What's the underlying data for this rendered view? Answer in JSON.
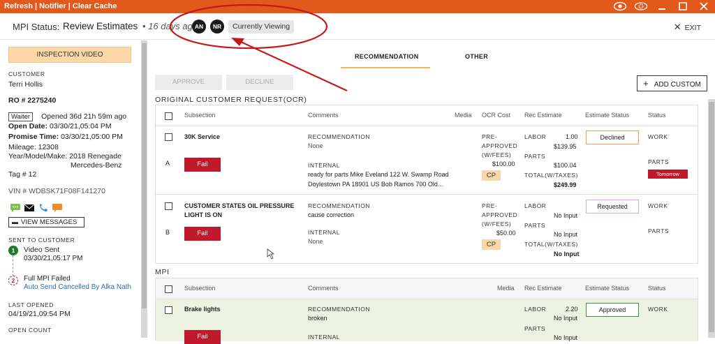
{
  "topbar": {
    "refresh": "Refresh",
    "sep1": " | ",
    "notifier": "Notifier",
    "sep2": " | ",
    "clear_cache": "Clear Cache"
  },
  "header": {
    "mpi_label": "MPI Status:",
    "mpi_value": "Review Estimates",
    "bullet": "•",
    "ago": "16 days ago",
    "avatar1": "AN",
    "avatar2": "NR",
    "currently_viewing": "Currently Viewing",
    "exit_icon": "✕",
    "exit": "EXIT"
  },
  "sidebar": {
    "inspection_video": "INSPECTION VIDEO",
    "customer_label": "CUSTOMER",
    "customer_name": "Terri Hollis",
    "ro": "RO # 2275240",
    "waiter": "Waiter",
    "opened": "Opened 36d 21h 59m ago",
    "open_date_label": "Open Date:",
    "open_date": "03/30/21,05:04 PM",
    "promise_label": "Promise Time:",
    "promise": "03/30/21,05:00 PM",
    "mileage_label": "Mileage:",
    "mileage": "12308",
    "ymm_label": "Year/Model/Make:",
    "ymm1": "2018 Renegade",
    "ymm2": "Mercedes-Benz",
    "tag": "Tag # 12",
    "vin": "VIN # WDBSK71F08F141270",
    "view_messages": "VIEW MESSAGES",
    "sent_label": "SENT TO CUSTOMER",
    "step1_num": "1",
    "step1_title": "Video Sent",
    "step1_time": "03/30/21,05:17 PM",
    "step2_num": "2",
    "step2_title": "Full MPI Failed",
    "step2_detail": "Auto Send Cancelled By Alka Nath",
    "last_opened_label": "LAST OPENED",
    "last_opened": "04/19/21,09:54 PM",
    "open_count_label": "OPEN COUNT"
  },
  "main": {
    "tabs": [
      {
        "label": "RECOMMENDATION",
        "active": true
      },
      {
        "label": "OTHER",
        "active": false
      }
    ],
    "approve": "APPROVE",
    "decline": "DECLINE",
    "add_custom": "ADD CUSTOM",
    "ocr_title": "ORIGINAL CUSTOMER REQUEST(OCR)",
    "ocr_headers": {
      "subsection": "Subsection",
      "comments": "Comments",
      "media": "Media",
      "ocr_cost": "OCR Cost",
      "rec_estimate": "Rec Estimate",
      "estimate_status": "Estimate Status",
      "status": "Status"
    },
    "ocr_rows": [
      {
        "letter": "A",
        "title": "30K Service",
        "title2": "",
        "fail": "Fail",
        "rec_label": "RECOMMENDATION",
        "rec_value": "None",
        "int_label": "INTERNAL",
        "int_line1": "ready for parts Mike Eveland 122 W. Swamp Road",
        "int_line2": "Doylestown PA 18901 US Bob Ramos 700 Old...",
        "pre1": "PRE-",
        "pre2": "APPROVED",
        "pre3": "(W/FEES)",
        "pre_amount": "$100.00",
        "cp": "CP",
        "labor": "LABOR",
        "labor_hours": "1.00",
        "labor_amount": "$139.95",
        "parts": "PARTS",
        "parts_amount": "$100.04",
        "total": "TOTAL(W/TAXES)",
        "total_amount": "$249.99",
        "estimate_status": "Declined",
        "status_work": "WORK",
        "status_parts": "PARTS",
        "status_badge": "Tomorrow"
      },
      {
        "letter": "B",
        "title": "CUSTOMER STATES OIL PRESSURE",
        "title2": "LIGHT IS ON",
        "fail": "Fail",
        "rec_label": "RECOMMENDATION",
        "rec_value": "cause correction",
        "int_label": "INTERNAL",
        "int_line1": "None",
        "int_line2": "",
        "pre1": "PRE-",
        "pre2": "APPROVED",
        "pre3": "(W/FEES)",
        "pre_amount": "$50.00",
        "cp": "CP",
        "labor": "LABOR",
        "labor_hours": "",
        "labor_amount": "No Input",
        "parts": "PARTS",
        "parts_amount": "No Input",
        "total": "TOTAL(W/TAXES)",
        "total_amount": "No Input",
        "estimate_status": "Requested",
        "status_work": "WORK",
        "status_parts": "PARTS",
        "status_badge": ""
      }
    ],
    "mpi_title": "MPI",
    "mpi_headers": {
      "subsection": "Subsection",
      "comments": "Comments",
      "media": "Media",
      "rec_estimate": "Rec Estimate",
      "estimate_status": "Estimate Status",
      "status": "Status"
    },
    "mpi_rows": [
      {
        "title": "Brake lights",
        "fail": "Fail",
        "rec_label": "RECOMMENDATION",
        "rec_value": "broken",
        "int_label": "INTERNAL",
        "labor": "LABOR",
        "labor_hours": "2.20",
        "labor_amount": "No Input",
        "parts": "PARTS",
        "parts_amount": "No Input",
        "estimate_status": "Approved",
        "status_work": "WORK"
      }
    ]
  },
  "colors": {
    "brand": "#e15a1c",
    "fail": "#c1182b",
    "approved": "#2e9a3c",
    "declined": "#f0a34a",
    "requested": "#d5a3e0",
    "annotation": "#c41a1a"
  },
  "icons": [
    "eye-icon",
    "settings-icon",
    "minimize-icon",
    "maximize-icon",
    "close-icon",
    "chat-icon",
    "mail-icon",
    "phone-icon",
    "message-icon",
    "plus-icon",
    "cursor-icon"
  ]
}
